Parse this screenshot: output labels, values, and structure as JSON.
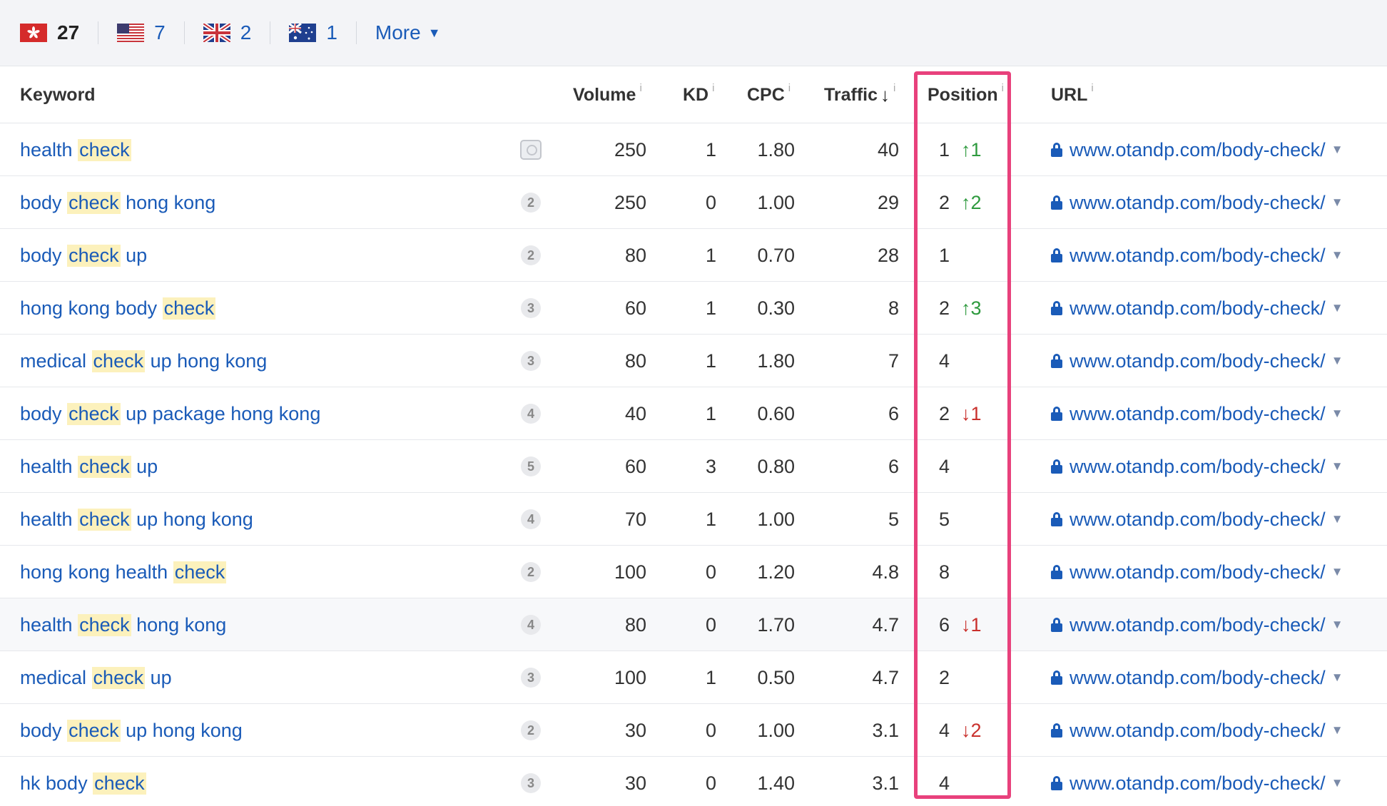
{
  "countries": [
    {
      "code": "HK",
      "count": "27",
      "active": true
    },
    {
      "code": "US",
      "count": "7"
    },
    {
      "code": "GB",
      "count": "2"
    },
    {
      "code": "AU",
      "count": "1"
    }
  ],
  "more_label": "More",
  "columns": {
    "keyword": "Keyword",
    "volume": "Volume",
    "kd": "KD",
    "cpc": "CPC",
    "traffic": "Traffic",
    "position": "Position",
    "url": "URL",
    "info": "i",
    "sort_arrow": "↓"
  },
  "rows": [
    {
      "kw_pre": "health ",
      "kw_hl": "check",
      "kw_post": "",
      "serp": "img",
      "volume": "250",
      "kd": "1",
      "cpc": "1.80",
      "traffic": "40",
      "position": "1",
      "change_dir": "up",
      "change": "1",
      "url": "www.otandp.com/body-check/"
    },
    {
      "kw_pre": "body ",
      "kw_hl": "check",
      "kw_post": " hong kong",
      "serp": "2",
      "volume": "250",
      "kd": "0",
      "cpc": "1.00",
      "traffic": "29",
      "position": "2",
      "change_dir": "up",
      "change": "2",
      "url": "www.otandp.com/body-check/"
    },
    {
      "kw_pre": "body ",
      "kw_hl": "check",
      "kw_post": " up",
      "serp": "2",
      "volume": "80",
      "kd": "1",
      "cpc": "0.70",
      "traffic": "28",
      "position": "1",
      "change_dir": "",
      "change": "",
      "url": "www.otandp.com/body-check/"
    },
    {
      "kw_pre": "hong kong body ",
      "kw_hl": "check",
      "kw_post": "",
      "serp": "3",
      "volume": "60",
      "kd": "1",
      "cpc": "0.30",
      "traffic": "8",
      "position": "2",
      "change_dir": "up",
      "change": "3",
      "url": "www.otandp.com/body-check/"
    },
    {
      "kw_pre": "medical ",
      "kw_hl": "check",
      "kw_post": " up hong kong",
      "serp": "3",
      "volume": "80",
      "kd": "1",
      "cpc": "1.80",
      "traffic": "7",
      "position": "4",
      "change_dir": "",
      "change": "",
      "url": "www.otandp.com/body-check/"
    },
    {
      "kw_pre": "body ",
      "kw_hl": "check",
      "kw_post": " up package hong kong",
      "serp": "4",
      "volume": "40",
      "kd": "1",
      "cpc": "0.60",
      "traffic": "6",
      "position": "2",
      "change_dir": "down",
      "change": "1",
      "url": "www.otandp.com/body-check/"
    },
    {
      "kw_pre": "health ",
      "kw_hl": "check",
      "kw_post": " up",
      "serp": "5",
      "volume": "60",
      "kd": "3",
      "cpc": "0.80",
      "traffic": "6",
      "position": "4",
      "change_dir": "",
      "change": "",
      "url": "www.otandp.com/body-check/"
    },
    {
      "kw_pre": "health ",
      "kw_hl": "check",
      "kw_post": " up hong kong",
      "serp": "4",
      "volume": "70",
      "kd": "1",
      "cpc": "1.00",
      "traffic": "5",
      "position": "5",
      "change_dir": "",
      "change": "",
      "url": "www.otandp.com/body-check/"
    },
    {
      "kw_pre": "hong kong health ",
      "kw_hl": "check",
      "kw_post": "",
      "serp": "2",
      "volume": "100",
      "kd": "0",
      "cpc": "1.20",
      "traffic": "4.8",
      "position": "8",
      "change_dir": "",
      "change": "",
      "url": "www.otandp.com/body-check/"
    },
    {
      "kw_pre": "health ",
      "kw_hl": "check",
      "kw_post": " hong kong",
      "serp": "4",
      "volume": "80",
      "kd": "0",
      "cpc": "1.70",
      "traffic": "4.7",
      "position": "6",
      "change_dir": "down",
      "change": "1",
      "url": "www.otandp.com/body-check/",
      "hover": true
    },
    {
      "kw_pre": "medical ",
      "kw_hl": "check",
      "kw_post": " up",
      "serp": "3",
      "volume": "100",
      "kd": "1",
      "cpc": "0.50",
      "traffic": "4.7",
      "position": "2",
      "change_dir": "",
      "change": "",
      "url": "www.otandp.com/body-check/"
    },
    {
      "kw_pre": "body ",
      "kw_hl": "check",
      "kw_post": " up hong kong",
      "serp": "2",
      "volume": "30",
      "kd": "0",
      "cpc": "1.00",
      "traffic": "3.1",
      "position": "4",
      "change_dir": "down",
      "change": "2",
      "url": "www.otandp.com/body-check/"
    },
    {
      "kw_pre": "hk body ",
      "kw_hl": "check",
      "kw_post": "",
      "serp": "3",
      "volume": "30",
      "kd": "0",
      "cpc": "1.40",
      "traffic": "3.1",
      "position": "4",
      "change_dir": "",
      "change": "",
      "url": "www.otandp.com/body-check/"
    }
  ],
  "colors": {
    "link": "#1a5bb8",
    "highlight": "#fcf1bc",
    "up": "#2e9a3e",
    "down": "#c9302c",
    "annotation": "#e8417c"
  }
}
